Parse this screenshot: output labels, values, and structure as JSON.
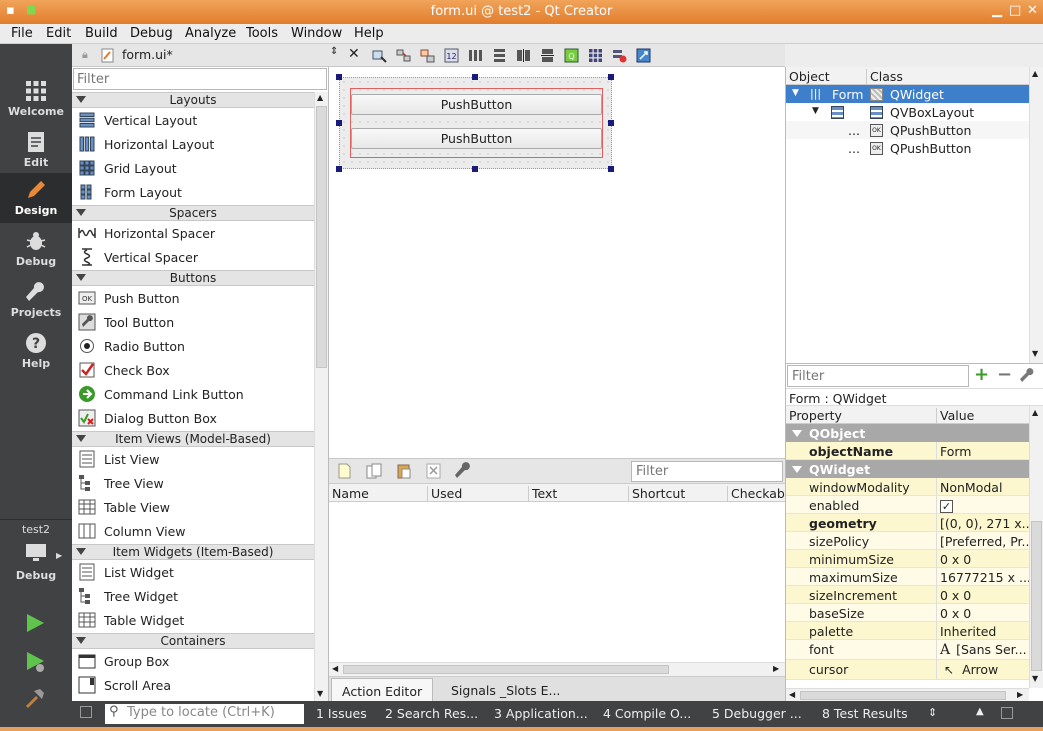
{
  "window": {
    "title": "form.ui @ test2 - Qt Creator"
  },
  "menu": [
    "File",
    "Edit",
    "Build",
    "Debug",
    "Analyze",
    "Tools",
    "Window",
    "Help"
  ],
  "modes": [
    {
      "label": "Welcome",
      "icon": "grid-icon"
    },
    {
      "label": "Edit",
      "icon": "document-icon"
    },
    {
      "label": "Design",
      "icon": "pencil-icon"
    },
    {
      "label": "Debug",
      "icon": "bug-icon"
    },
    {
      "label": "Projects",
      "icon": "wrench-icon"
    },
    {
      "label": "Help",
      "icon": "help-icon"
    }
  ],
  "kit": {
    "project": "test2",
    "config": "Debug"
  },
  "editor": {
    "file_name": "form.ui*"
  },
  "widget_box": {
    "filter_placeholder": "Filter",
    "categories": [
      {
        "title": "Layouts",
        "items": [
          "Vertical Layout",
          "Horizontal Layout",
          "Grid Layout",
          "Form Layout"
        ]
      },
      {
        "title": "Spacers",
        "items": [
          "Horizontal Spacer",
          "Vertical Spacer"
        ]
      },
      {
        "title": "Buttons",
        "items": [
          "Push Button",
          "Tool Button",
          "Radio Button",
          "Check Box",
          "Command Link Button",
          "Dialog Button Box"
        ]
      },
      {
        "title": "Item Views (Model-Based)",
        "items": [
          "List View",
          "Tree View",
          "Table View",
          "Column View"
        ]
      },
      {
        "title": "Item Widgets (Item-Based)",
        "items": [
          "List Widget",
          "Tree Widget",
          "Table Widget"
        ]
      },
      {
        "title": "Containers",
        "items": [
          "Group Box",
          "Scroll Area"
        ]
      }
    ]
  },
  "form": {
    "buttons": [
      "PushButton",
      "PushButton"
    ]
  },
  "action_editor": {
    "filter_placeholder": "Filter",
    "columns": [
      "Name",
      "Used",
      "Text",
      "Shortcut",
      "Checkabl"
    ],
    "tabs": [
      "Action Editor",
      "Signals _Slots E..."
    ]
  },
  "object_inspector": {
    "columns": [
      "Object",
      "Class"
    ],
    "rows": [
      {
        "object": "Form",
        "class": "QWidget"
      },
      {
        "object": "",
        "class": "QVBoxLayout"
      },
      {
        "object": "...",
        "class": "QPushButton"
      },
      {
        "object": "...",
        "class": "QPushButton"
      }
    ]
  },
  "property_editor": {
    "filter_placeholder": "Filter",
    "caption": "Form : QWidget",
    "columns": [
      "Property",
      "Value"
    ],
    "groups": {
      "qobject": "QObject",
      "qwidget": "QWidget"
    },
    "props": {
      "objectName": {
        "name": "objectName",
        "value": "Form"
      },
      "windowModality": {
        "name": "windowModality",
        "value": "NonModal"
      },
      "enabled": {
        "name": "enabled",
        "value": "✓"
      },
      "geometry": {
        "name": "geometry",
        "value": "[(0, 0), 271 x..."
      },
      "sizePolicy": {
        "name": "sizePolicy",
        "value": "[Preferred, Pr..."
      },
      "minimumSize": {
        "name": "minimumSize",
        "value": "0 x 0"
      },
      "maximumSize": {
        "name": "maximumSize",
        "value": "16777215 x ..."
      },
      "sizeIncrement": {
        "name": "sizeIncrement",
        "value": "0 x 0"
      },
      "baseSize": {
        "name": "baseSize",
        "value": "0 x 0"
      },
      "palette": {
        "name": "palette",
        "value": "Inherited"
      },
      "font": {
        "name": "font",
        "value": "[Sans Ser..."
      },
      "cursor": {
        "name": "cursor",
        "value": "Arrow"
      }
    }
  },
  "statusbar": {
    "locator_placeholder": "Type to locate (Ctrl+K)",
    "panes": [
      "1  Issues",
      "2  Search Res...",
      "3  Application...",
      "4  Compile O...",
      "5  Debugger ...",
      "8  Test Results"
    ]
  }
}
